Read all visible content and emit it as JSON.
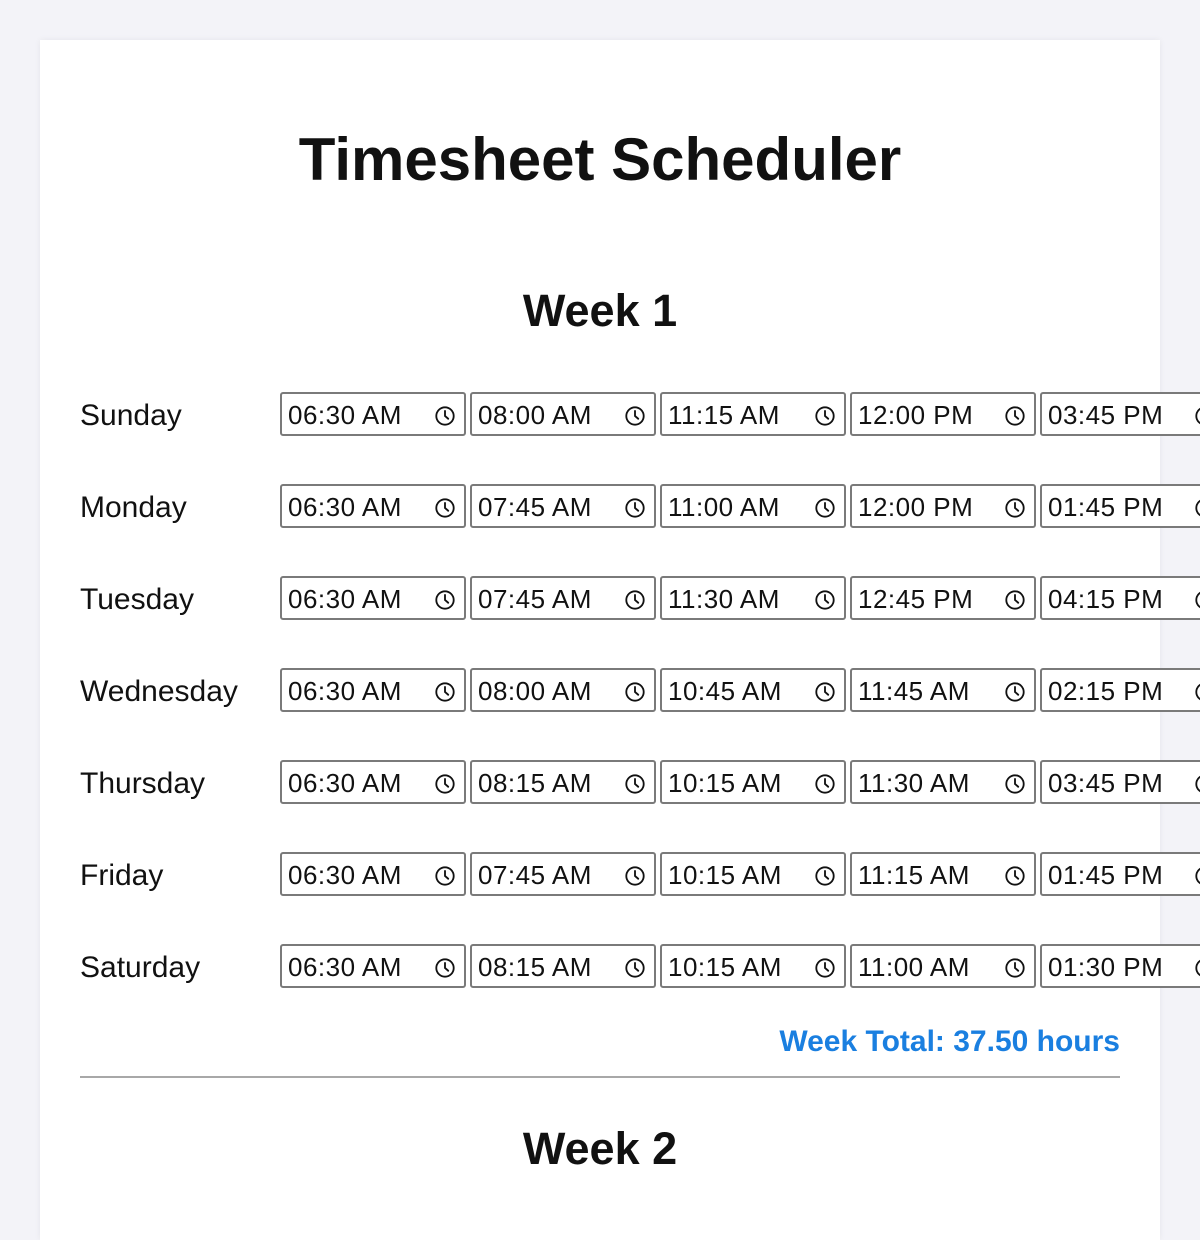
{
  "page": {
    "title": "Timesheet Scheduler"
  },
  "weeks": [
    {
      "heading": "Week 1",
      "days": [
        {
          "label": "Sunday",
          "times": [
            "06:30 AM",
            "08:00 AM",
            "11:15 AM",
            "12:00 PM",
            "03:45 PM"
          ]
        },
        {
          "label": "Monday",
          "times": [
            "06:30 AM",
            "07:45 AM",
            "11:00 AM",
            "12:00 PM",
            "01:45 PM"
          ]
        },
        {
          "label": "Tuesday",
          "times": [
            "06:30 AM",
            "07:45 AM",
            "11:30 AM",
            "12:45 PM",
            "04:15 PM"
          ]
        },
        {
          "label": "Wednesday",
          "times": [
            "06:30 AM",
            "08:00 AM",
            "10:45 AM",
            "11:45 AM",
            "02:15 PM"
          ]
        },
        {
          "label": "Thursday",
          "times": [
            "06:30 AM",
            "08:15 AM",
            "10:15 AM",
            "11:30 AM",
            "03:45 PM"
          ]
        },
        {
          "label": "Friday",
          "times": [
            "06:30 AM",
            "07:45 AM",
            "10:15 AM",
            "11:15 AM",
            "01:45 PM"
          ]
        },
        {
          "label": "Saturday",
          "times": [
            "06:30 AM",
            "08:15 AM",
            "10:15 AM",
            "11:00 AM",
            "01:30 PM"
          ]
        }
      ],
      "total": "Week Total: 37.50 hours"
    },
    {
      "heading": "Week 2"
    }
  ],
  "icons": {
    "time_input_icon": "clock-icon"
  },
  "colors": {
    "accent": "#1a7fe0",
    "background": "#f3f3f8",
    "card": "#ffffff",
    "input_border": "#7a7a7a",
    "divider": "#a8a8a8"
  }
}
